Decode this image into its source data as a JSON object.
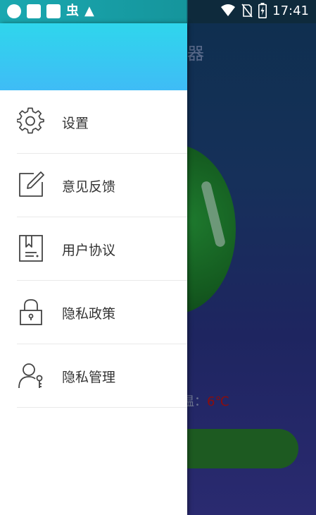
{
  "status_bar": {
    "time": "17:41",
    "left_icons": [
      "circle-icon",
      "square-icon",
      "square-icon",
      "bug-icon",
      "warning-icon"
    ],
    "right_icons": [
      "wifi-icon",
      "no-sim-icon",
      "battery-charging-icon"
    ],
    "bug_glyph": "虫",
    "warning_glyph": "▲"
  },
  "background_screen": {
    "title_fragment": "器",
    "temp_label": "温：",
    "temp_value": "6℃"
  },
  "drawer": {
    "items": [
      {
        "label": "设置",
        "icon": "gear-icon"
      },
      {
        "label": "意见反馈",
        "icon": "edit-icon"
      },
      {
        "label": "用户协议",
        "icon": "document-icon"
      },
      {
        "label": "隐私政策",
        "icon": "lock-icon"
      },
      {
        "label": "隐私管理",
        "icon": "user-key-icon"
      }
    ]
  },
  "colors": {
    "header_top": "#2fd6ec",
    "header_bottom": "#3fbcf6",
    "icon_stroke": "#444444",
    "text": "#333333",
    "temp_value": "#8a0d0d"
  }
}
